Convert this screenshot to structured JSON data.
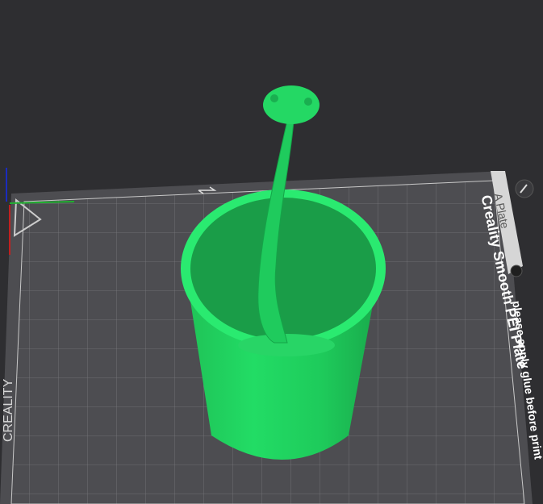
{
  "plate": {
    "tab_label": "A Plate",
    "name": "Creality Smooth PEI Plate",
    "note": "please apply glue before print",
    "brand_logo": "CREALITY"
  },
  "icons": {
    "edit": "pencil-icon",
    "lock": "lock-icon",
    "axes": "axis-gizmo"
  },
  "colors": {
    "model": "#22dd66",
    "bed": "#4a4a4e",
    "grid": "#7a7a7e",
    "background": "#2e2e31"
  }
}
